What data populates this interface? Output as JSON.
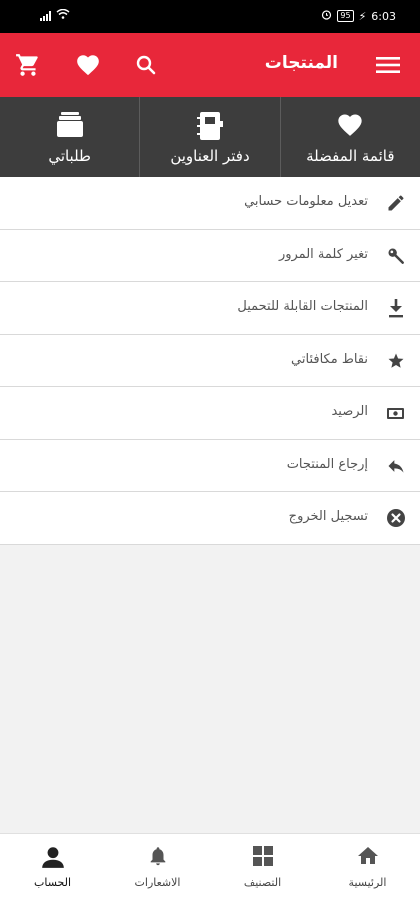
{
  "status_bar": {
    "time": "6:03",
    "battery": "95"
  },
  "app_bar": {
    "title": "المنتجات"
  },
  "tiles": [
    {
      "label": "طلباتي",
      "icon": "orders-box-icon"
    },
    {
      "label": "دفتر العناوين",
      "icon": "address-book-icon"
    },
    {
      "label": "قائمة المفضلة",
      "icon": "heart-icon"
    }
  ],
  "menu": [
    {
      "label": "تعديل معلومات حسابي",
      "icon": "pencil-icon"
    },
    {
      "label": "تغير كلمة المرور",
      "icon": "key-icon"
    },
    {
      "label": "المنتجات القابلة للتحميل",
      "icon": "download-icon"
    },
    {
      "label": "نقاط مكافئاتي",
      "icon": "star-icon"
    },
    {
      "label": "الرصيد",
      "icon": "money-icon"
    },
    {
      "label": "إرجاع المنتجات",
      "icon": "reply-icon"
    },
    {
      "label": "تسجيل الخروج",
      "icon": "close-circle-icon"
    }
  ],
  "bottom_nav": [
    {
      "label": "الحساب",
      "icon": "person-icon",
      "active": true
    },
    {
      "label": "الاشعارات",
      "icon": "bell-icon",
      "active": false
    },
    {
      "label": "التصنيف",
      "icon": "category-grid-icon",
      "active": false
    },
    {
      "label": "الرئيسية",
      "icon": "home-icon",
      "active": false
    }
  ],
  "colors": {
    "primary": "#e8273a",
    "tile_bg": "#3d3d3d",
    "status_bar": "#000000"
  }
}
